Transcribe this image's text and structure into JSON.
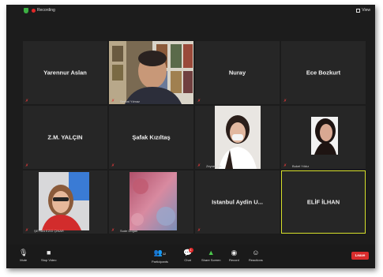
{
  "topbar": {
    "recording_label": "Recording",
    "view_label": "View"
  },
  "tiles": [
    {
      "name": "Yarennur Aslan"
    },
    {
      "label": "Serhat Yılmaz"
    },
    {
      "name": "Nuray"
    },
    {
      "name": "Ece Bozkurt"
    },
    {
      "name": "Z.M. YALÇIN"
    },
    {
      "name": "Şafak Kızıltaş"
    },
    {
      "label": "Zeynep Çit."
    },
    {
      "label": "Buket Yıldız"
    },
    {
      "label": "ŞEYMA EZGİ ÇINAR"
    },
    {
      "label": "Sude Doğan"
    },
    {
      "name": "Istanbul Aydin U..."
    },
    {
      "name": "ELİF İLHAN"
    }
  ],
  "toolbar": {
    "mute": "Mute",
    "stop_video": "Stop Video",
    "participants": "Participants",
    "participants_count": "12",
    "chat": "Chat",
    "chat_badge": "1",
    "share_screen": "Share Screen",
    "record": "Record",
    "reactions": "Reactions",
    "leave": "Leave"
  },
  "colors": {
    "background": "#1c1c1c",
    "tile": "#262626",
    "active_border": "#d6e02a",
    "leave": "#d92c2c",
    "share": "#4cc94c"
  }
}
